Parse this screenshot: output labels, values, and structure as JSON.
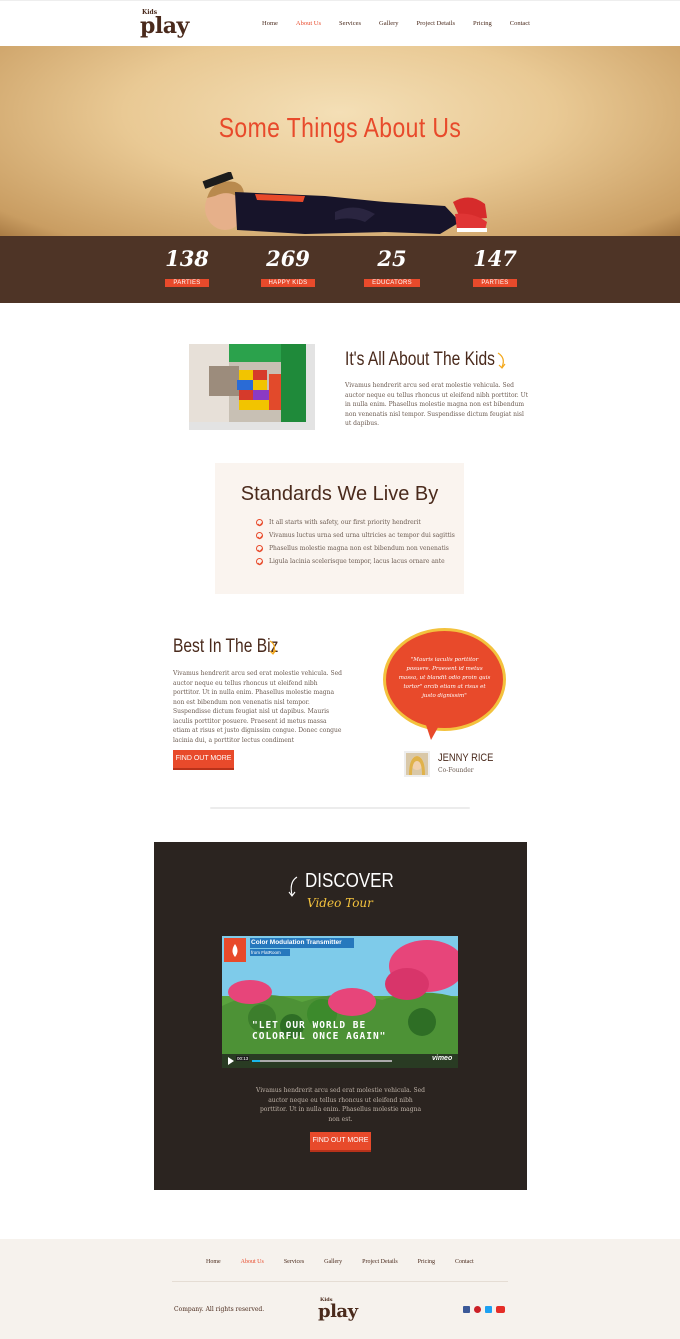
{
  "header": {
    "logo": {
      "small": "Kids",
      "big": "play"
    },
    "nav": [
      {
        "label": "Home",
        "active": false
      },
      {
        "label": "About Us",
        "active": true
      },
      {
        "label": "Services",
        "active": false
      },
      {
        "label": "Gallery",
        "active": false
      },
      {
        "label": "Project Details",
        "active": false
      },
      {
        "label": "Pricing",
        "active": false
      },
      {
        "label": "Contact",
        "active": false
      }
    ]
  },
  "hero": {
    "title": "Some Things About Us",
    "stats": [
      {
        "number": "138",
        "label": "PARTIES"
      },
      {
        "number": "269",
        "label": "HAPPY KIDS"
      },
      {
        "number": "25",
        "label": "EDUCATORS"
      },
      {
        "number": "147",
        "label": "PARTIES"
      }
    ]
  },
  "kids": {
    "title": "It's All About The Kids",
    "text": "Vivamus hendrerit arcu sed erat molestie vehicula. Sed auctor neque eu tellus rhoncus ut eleifend nibh porttitor. Ut in nulla enim. Phasellus molestie magna non est bibendum non venenatis nisl tempor. Suspendisse dictum feugiat nisl ut dapibus."
  },
  "standards": {
    "title": "Standards We Live By",
    "items": [
      "It all starts with safety, our first priority hendrerit",
      "Vivamus luctus urna sed urna ultricies ac tempor dui sagittis",
      "Phasellus molestie magna non est bibendum non venenatis",
      "Ligula lacinia scelerisque tempor, lacus lacus ornare ante"
    ]
  },
  "biz": {
    "title": "Best In The Biz",
    "text": "Vivamus hendrerit arcu sed erat molestie vehicula. Sed auctor neque eu tellus rhoncus ut eleifend nibh porttitor. Ut in nulla enim. Phasellus molestie magna non est bibendum non venenatis nisl tempor. Suspendisse dictum feugiat nisl ut dapibus. Mauris iaculis porttitor posuere. Praesent id metus massa etiam at risus et justo dignissim congue. Donec congue lacinia dui, a porttitor lectus condiment",
    "button": "FIND OUT MORE",
    "quote": "\"Mauris iaculis porttitor posuere. Praesent id metus massa, ut blandit odio proin quis tortor\" orcib etiam at risus et justo dignissim\"",
    "person_name": "JENNY RICE",
    "person_role": "Co-Founder"
  },
  "discover": {
    "title": "DISCOVER",
    "subtitle": "Video Tour",
    "video": {
      "title": "Color Modulation Transmitter",
      "from": "from FlatRoom",
      "overlay": "\"LET OUR WORLD BE COLORFUL ONCE AGAIN\"",
      "time": "00:13",
      "brand": "vimeo"
    },
    "text": "Vivamus hendrerit arcu sed erat molestie vehicula. Sed auctor neque eu tellus rhoncus ut eleifend nibh porttitor. Ut in nulla enim. Phasellus molestie magna non est.",
    "button": "FIND OUT MORE"
  },
  "footer": {
    "nav": [
      {
        "label": "Home",
        "active": false
      },
      {
        "label": "About Us",
        "active": true
      },
      {
        "label": "Services",
        "active": false
      },
      {
        "label": "Gallery",
        "active": false
      },
      {
        "label": "Project Details",
        "active": false
      },
      {
        "label": "Pricing",
        "active": false
      },
      {
        "label": "Contact",
        "active": false
      }
    ],
    "copyright": "Company. All rights reserved.",
    "logo": {
      "small": "Kids",
      "big": "play"
    },
    "social": [
      {
        "name": "facebook-icon",
        "color": "#3b5998"
      },
      {
        "name": "pinterest-icon",
        "color": "#cb2027"
      },
      {
        "name": "twitter-icon",
        "color": "#1da1f2"
      },
      {
        "name": "youtube-icon",
        "color": "#e52d27"
      }
    ]
  },
  "colors": {
    "accent": "#e84a2b",
    "brown": "#4e3426",
    "yellow": "#f3c23d"
  }
}
